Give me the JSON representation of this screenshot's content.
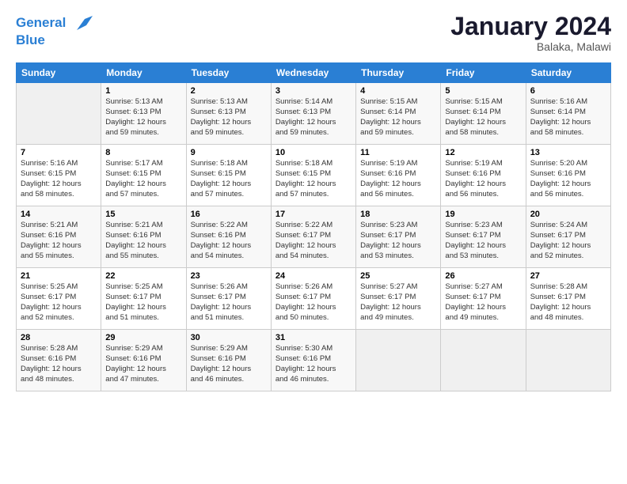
{
  "header": {
    "logo_line1": "General",
    "logo_line2": "Blue",
    "title": "January 2024",
    "location": "Balaka, Malawi"
  },
  "columns": [
    "Sunday",
    "Monday",
    "Tuesday",
    "Wednesday",
    "Thursday",
    "Friday",
    "Saturday"
  ],
  "weeks": [
    [
      {
        "day": "",
        "info": ""
      },
      {
        "day": "1",
        "info": "Sunrise: 5:13 AM\nSunset: 6:13 PM\nDaylight: 12 hours\nand 59 minutes."
      },
      {
        "day": "2",
        "info": "Sunrise: 5:13 AM\nSunset: 6:13 PM\nDaylight: 12 hours\nand 59 minutes."
      },
      {
        "day": "3",
        "info": "Sunrise: 5:14 AM\nSunset: 6:13 PM\nDaylight: 12 hours\nand 59 minutes."
      },
      {
        "day": "4",
        "info": "Sunrise: 5:15 AM\nSunset: 6:14 PM\nDaylight: 12 hours\nand 59 minutes."
      },
      {
        "day": "5",
        "info": "Sunrise: 5:15 AM\nSunset: 6:14 PM\nDaylight: 12 hours\nand 58 minutes."
      },
      {
        "day": "6",
        "info": "Sunrise: 5:16 AM\nSunset: 6:14 PM\nDaylight: 12 hours\nand 58 minutes."
      }
    ],
    [
      {
        "day": "7",
        "info": "Sunrise: 5:16 AM\nSunset: 6:15 PM\nDaylight: 12 hours\nand 58 minutes."
      },
      {
        "day": "8",
        "info": "Sunrise: 5:17 AM\nSunset: 6:15 PM\nDaylight: 12 hours\nand 57 minutes."
      },
      {
        "day": "9",
        "info": "Sunrise: 5:18 AM\nSunset: 6:15 PM\nDaylight: 12 hours\nand 57 minutes."
      },
      {
        "day": "10",
        "info": "Sunrise: 5:18 AM\nSunset: 6:15 PM\nDaylight: 12 hours\nand 57 minutes."
      },
      {
        "day": "11",
        "info": "Sunrise: 5:19 AM\nSunset: 6:16 PM\nDaylight: 12 hours\nand 56 minutes."
      },
      {
        "day": "12",
        "info": "Sunrise: 5:19 AM\nSunset: 6:16 PM\nDaylight: 12 hours\nand 56 minutes."
      },
      {
        "day": "13",
        "info": "Sunrise: 5:20 AM\nSunset: 6:16 PM\nDaylight: 12 hours\nand 56 minutes."
      }
    ],
    [
      {
        "day": "14",
        "info": "Sunrise: 5:21 AM\nSunset: 6:16 PM\nDaylight: 12 hours\nand 55 minutes."
      },
      {
        "day": "15",
        "info": "Sunrise: 5:21 AM\nSunset: 6:16 PM\nDaylight: 12 hours\nand 55 minutes."
      },
      {
        "day": "16",
        "info": "Sunrise: 5:22 AM\nSunset: 6:16 PM\nDaylight: 12 hours\nand 54 minutes."
      },
      {
        "day": "17",
        "info": "Sunrise: 5:22 AM\nSunset: 6:17 PM\nDaylight: 12 hours\nand 54 minutes."
      },
      {
        "day": "18",
        "info": "Sunrise: 5:23 AM\nSunset: 6:17 PM\nDaylight: 12 hours\nand 53 minutes."
      },
      {
        "day": "19",
        "info": "Sunrise: 5:23 AM\nSunset: 6:17 PM\nDaylight: 12 hours\nand 53 minutes."
      },
      {
        "day": "20",
        "info": "Sunrise: 5:24 AM\nSunset: 6:17 PM\nDaylight: 12 hours\nand 52 minutes."
      }
    ],
    [
      {
        "day": "21",
        "info": "Sunrise: 5:25 AM\nSunset: 6:17 PM\nDaylight: 12 hours\nand 52 minutes."
      },
      {
        "day": "22",
        "info": "Sunrise: 5:25 AM\nSunset: 6:17 PM\nDaylight: 12 hours\nand 51 minutes."
      },
      {
        "day": "23",
        "info": "Sunrise: 5:26 AM\nSunset: 6:17 PM\nDaylight: 12 hours\nand 51 minutes."
      },
      {
        "day": "24",
        "info": "Sunrise: 5:26 AM\nSunset: 6:17 PM\nDaylight: 12 hours\nand 50 minutes."
      },
      {
        "day": "25",
        "info": "Sunrise: 5:27 AM\nSunset: 6:17 PM\nDaylight: 12 hours\nand 49 minutes."
      },
      {
        "day": "26",
        "info": "Sunrise: 5:27 AM\nSunset: 6:17 PM\nDaylight: 12 hours\nand 49 minutes."
      },
      {
        "day": "27",
        "info": "Sunrise: 5:28 AM\nSunset: 6:17 PM\nDaylight: 12 hours\nand 48 minutes."
      }
    ],
    [
      {
        "day": "28",
        "info": "Sunrise: 5:28 AM\nSunset: 6:16 PM\nDaylight: 12 hours\nand 48 minutes."
      },
      {
        "day": "29",
        "info": "Sunrise: 5:29 AM\nSunset: 6:16 PM\nDaylight: 12 hours\nand 47 minutes."
      },
      {
        "day": "30",
        "info": "Sunrise: 5:29 AM\nSunset: 6:16 PM\nDaylight: 12 hours\nand 46 minutes."
      },
      {
        "day": "31",
        "info": "Sunrise: 5:30 AM\nSunset: 6:16 PM\nDaylight: 12 hours\nand 46 minutes."
      },
      {
        "day": "",
        "info": ""
      },
      {
        "day": "",
        "info": ""
      },
      {
        "day": "",
        "info": ""
      }
    ]
  ]
}
